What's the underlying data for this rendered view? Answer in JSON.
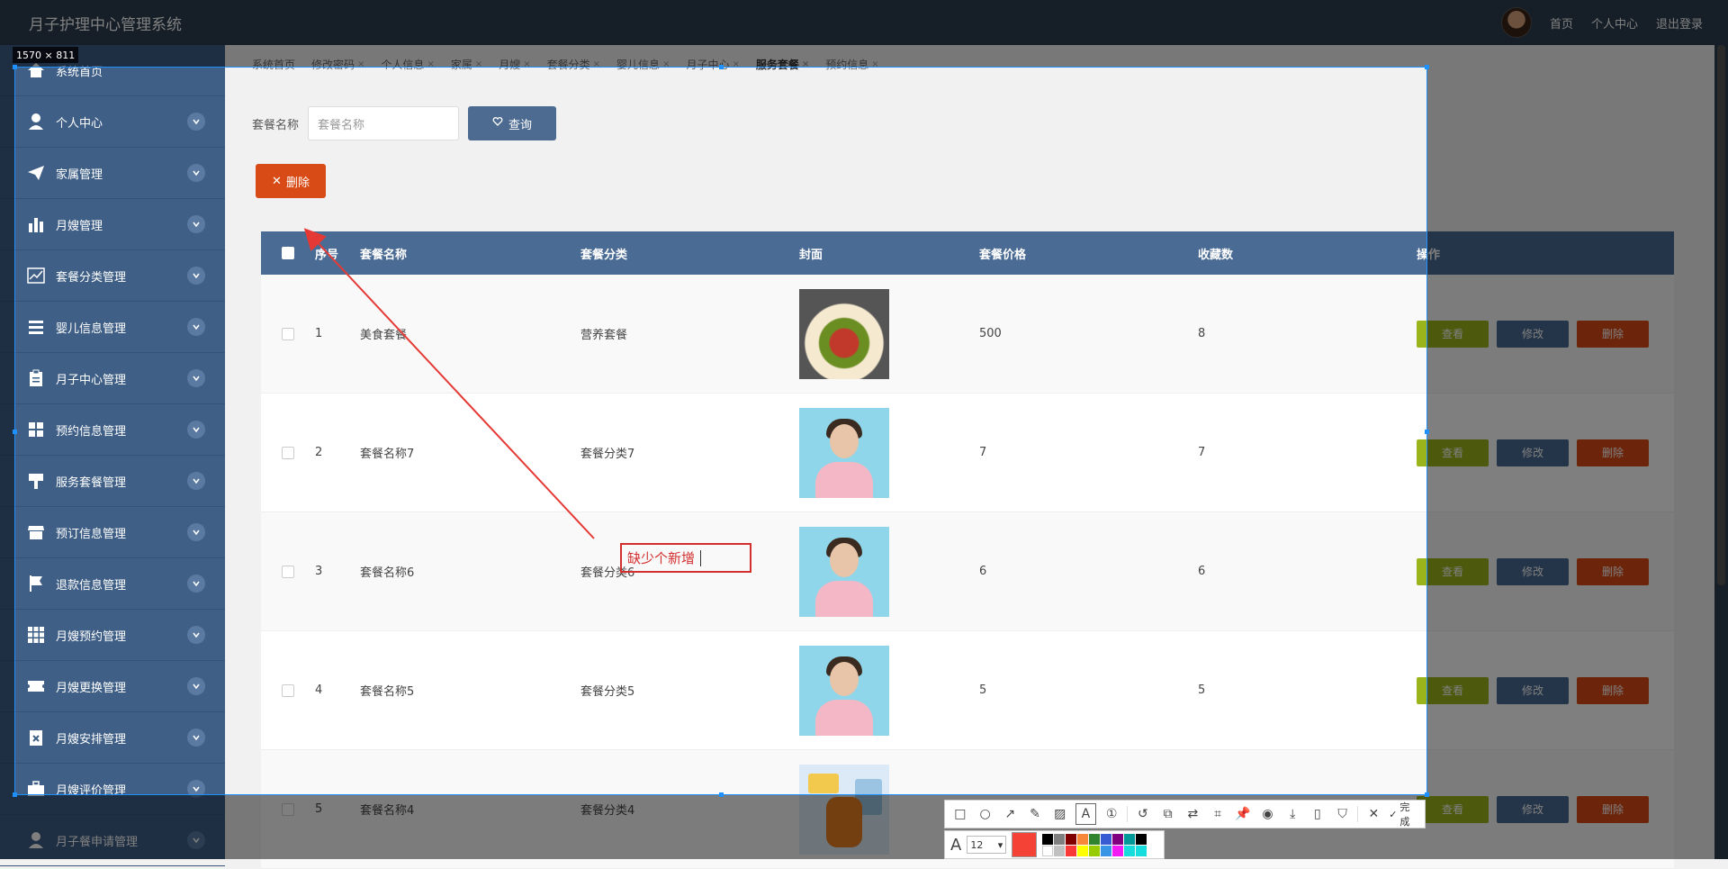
{
  "header": {
    "title": "月子护理中心管理系统",
    "links": [
      "首页",
      "个人中心",
      "退出登录"
    ]
  },
  "sidebar": {
    "items": [
      {
        "label": "系统首页",
        "icon": "home-icon"
      },
      {
        "label": "个人中心",
        "icon": "user-icon"
      },
      {
        "label": "家属管理",
        "icon": "paper-plane-icon"
      },
      {
        "label": "月嫂管理",
        "icon": "bar-chart-icon"
      },
      {
        "label": "套餐分类管理",
        "icon": "line-chart-icon"
      },
      {
        "label": "婴儿信息管理",
        "icon": "list-icon"
      },
      {
        "label": "月子中心管理",
        "icon": "clipboard-icon"
      },
      {
        "label": "预约信息管理",
        "icon": "grid-icon"
      },
      {
        "label": "服务套餐管理",
        "icon": "brush-icon"
      },
      {
        "label": "预订信息管理",
        "icon": "store-icon"
      },
      {
        "label": "退款信息管理",
        "icon": "flag-icon"
      },
      {
        "label": "月嫂预约管理",
        "icon": "apps-icon"
      },
      {
        "label": "月嫂更换管理",
        "icon": "ticket-icon"
      },
      {
        "label": "月嫂安排管理",
        "icon": "cancel-doc-icon"
      },
      {
        "label": "月嫂评价管理",
        "icon": "briefcase-icon"
      },
      {
        "label": "月子餐申请管理",
        "icon": "user-icon"
      }
    ]
  },
  "tabs": [
    {
      "label": "系统首页",
      "closable": false
    },
    {
      "label": "修改密码",
      "closable": true
    },
    {
      "label": "个人信息",
      "closable": true
    },
    {
      "label": "家属",
      "closable": true
    },
    {
      "label": "月嫂",
      "closable": true
    },
    {
      "label": "套餐分类",
      "closable": true
    },
    {
      "label": "婴儿信息",
      "closable": true
    },
    {
      "label": "月子中心",
      "closable": true
    },
    {
      "label": "服务套餐",
      "closable": true,
      "active": true
    },
    {
      "label": "预约信息",
      "closable": true
    }
  ],
  "search": {
    "label": "套餐名称",
    "placeholder": "套餐名称",
    "button": "查询"
  },
  "actions": {
    "delete": "删除"
  },
  "table": {
    "columns": [
      "序号",
      "套餐名称",
      "套餐分类",
      "封面",
      "套餐价格",
      "收藏数",
      "操作"
    ],
    "rows": [
      {
        "no": "1",
        "name": "美食套餐",
        "category": "营养套餐",
        "image": "food",
        "price": "500",
        "fav": "8"
      },
      {
        "no": "2",
        "name": "套餐名称7",
        "category": "套餐分类7",
        "image": "person",
        "price": "7",
        "fav": "7"
      },
      {
        "no": "3",
        "name": "套餐名称6",
        "category": "套餐分类6",
        "image": "person",
        "price": "6",
        "fav": "6"
      },
      {
        "no": "4",
        "name": "套餐名称5",
        "category": "套餐分类5",
        "image": "person",
        "price": "5",
        "fav": "5"
      },
      {
        "no": "5",
        "name": "套餐名称4",
        "category": "套餐分类4",
        "image": "cartoon",
        "price": "",
        "fav": ""
      }
    ],
    "ops": {
      "view": "查看",
      "edit": "修改",
      "delete": "删除"
    }
  },
  "screenshot_tool": {
    "size_label": "1570 × 811",
    "annotation_text": "缺少个新增",
    "done_label": "完成",
    "font_size": "12",
    "current_color": "#f44336",
    "palette": [
      "#000000",
      "#808080",
      "#800000",
      "#f7883a",
      "#308430",
      "#385ad3",
      "#800080",
      "#009999",
      "#ffffff",
      "#c0c0c0",
      "#fb3838",
      "#ffff00",
      "#99cc00",
      "#3894e4",
      "#f31bf3",
      "#16dcdc"
    ]
  },
  "colors": {
    "topbar": "#2c3e50",
    "sidebar": "#3f5f86",
    "accent": "#4a6b93",
    "danger": "#d84b16",
    "view": "#9ab41c"
  }
}
